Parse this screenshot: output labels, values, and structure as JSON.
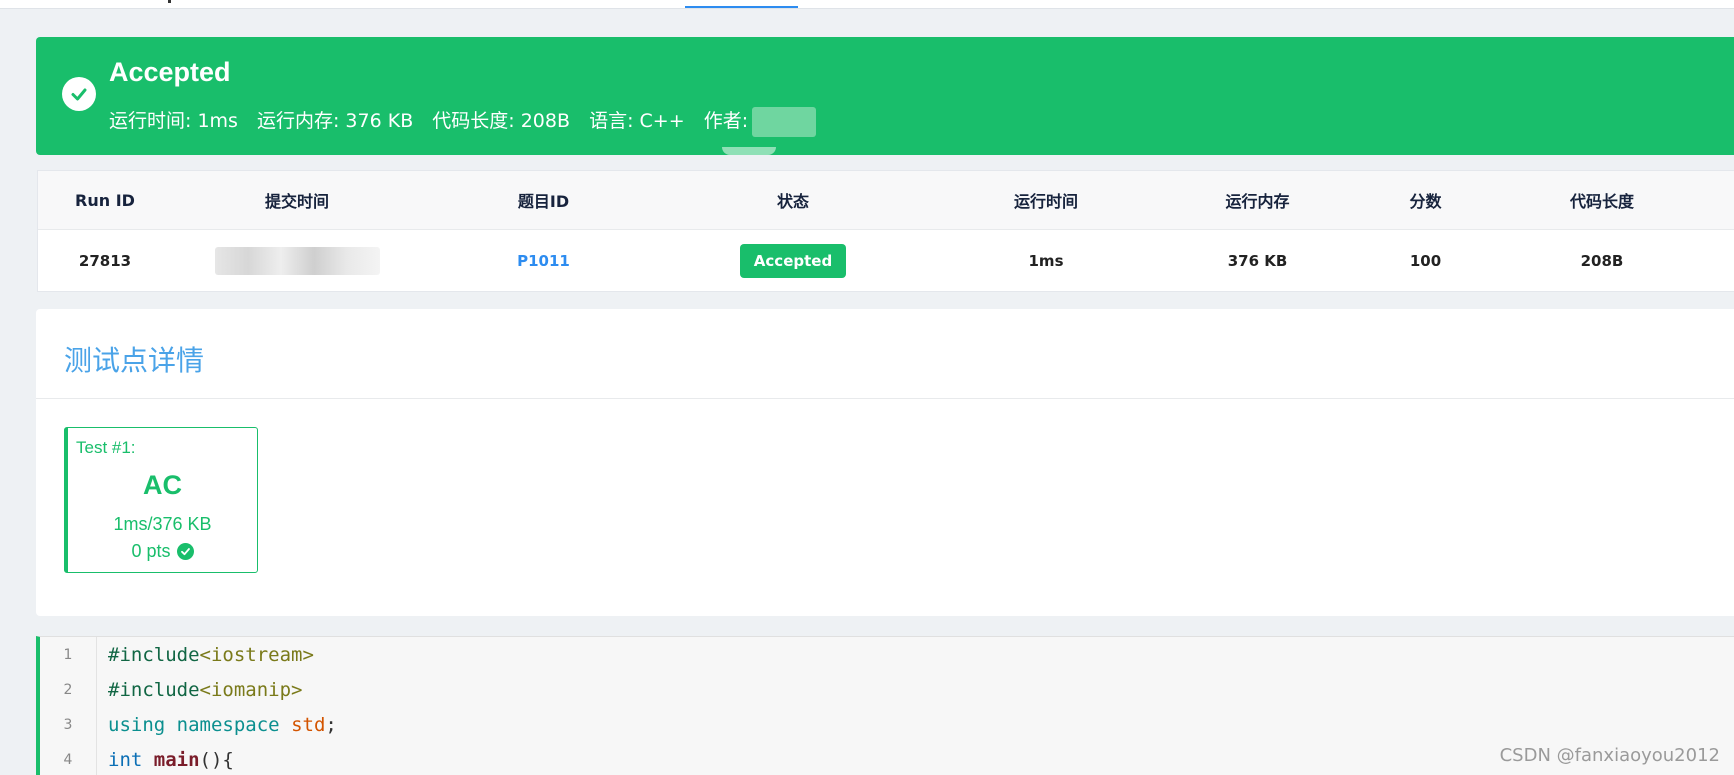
{
  "colors": {
    "accent_green": "#19be6b",
    "link_blue": "#2d8cf0",
    "title_blue": "#4aa3e8"
  },
  "banner": {
    "title": "Accepted",
    "run_time": "运行时间: 1ms",
    "memory": "运行内存: 376 KB",
    "code_length": "代码长度: 208B",
    "language": "语言: C++",
    "author_label": "作者:"
  },
  "table": {
    "headers": [
      "Run ID",
      "提交时间",
      "题目ID",
      "状态",
      "运行时间",
      "运行内存",
      "分数",
      "代码长度"
    ],
    "row": {
      "run_id": "27813",
      "problem_id": "P1011",
      "status": "Accepted",
      "run_time": "1ms",
      "memory": "376 KB",
      "score": "100",
      "code_length": "208B"
    }
  },
  "tests": {
    "title": "测试点详情",
    "items": [
      {
        "label": "Test #1:",
        "result": "AC",
        "usage": "1ms/376 KB",
        "score": "0 pts"
      }
    ]
  },
  "code": {
    "line_numbers": [
      "1",
      "2",
      "3",
      "4"
    ],
    "lines": [
      {
        "parts": [
          "#include",
          "<iostream>"
        ]
      },
      {
        "parts": [
          "#include",
          "<iomanip>"
        ]
      },
      {
        "parts": [
          "using",
          " ",
          "namespace",
          " ",
          "std",
          ";"
        ]
      },
      {
        "parts": [
          "int",
          " ",
          "main",
          "(){"
        ]
      }
    ]
  },
  "watermark": "CSDN @fanxiaoyou2012"
}
